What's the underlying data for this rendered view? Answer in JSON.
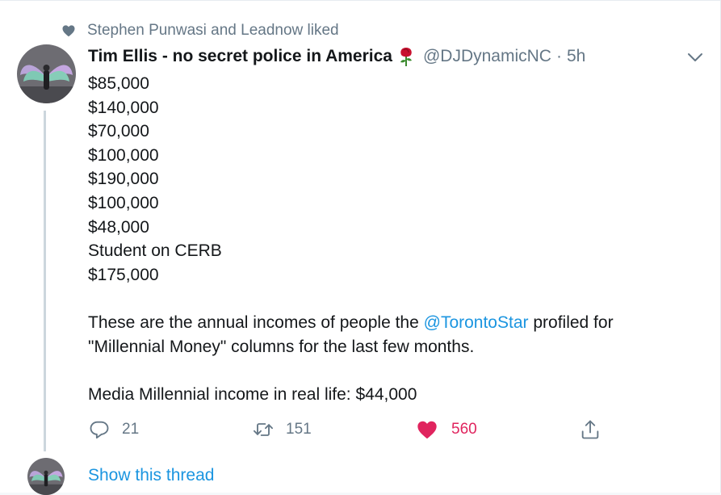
{
  "social_context": {
    "text": "Stephen Punwasi and Leadnow liked",
    "icon": "heart-icon"
  },
  "tweet": {
    "author_name": "Tim Ellis - no secret police in America",
    "author_emoji": "rose",
    "handle": "@DJDynamicNC",
    "separator": "·",
    "time": "5h",
    "lines": [
      "$85,000",
      "$140,000",
      "$70,000",
      "$100,000",
      "$190,000",
      "$100,000",
      "$48,000",
      "Student on CERB",
      "$175,000"
    ],
    "para1_before": "These are the annual incomes of people the ",
    "para1_mention": "@TorontoStar",
    "para1_after": " profiled for",
    "para1_line2": "\"Millennial Money\" columns for the last few months.",
    "para2": "Media Millennial income in real life: $44,000"
  },
  "actions": {
    "reply_count": "21",
    "retweet_count": "151",
    "like_count": "560",
    "like_color": "#e0245e"
  },
  "show_thread_label": "Show this thread",
  "colors": {
    "link": "#1b95e0",
    "secondary": "#657786",
    "thread_line": "#ccd6dd"
  }
}
